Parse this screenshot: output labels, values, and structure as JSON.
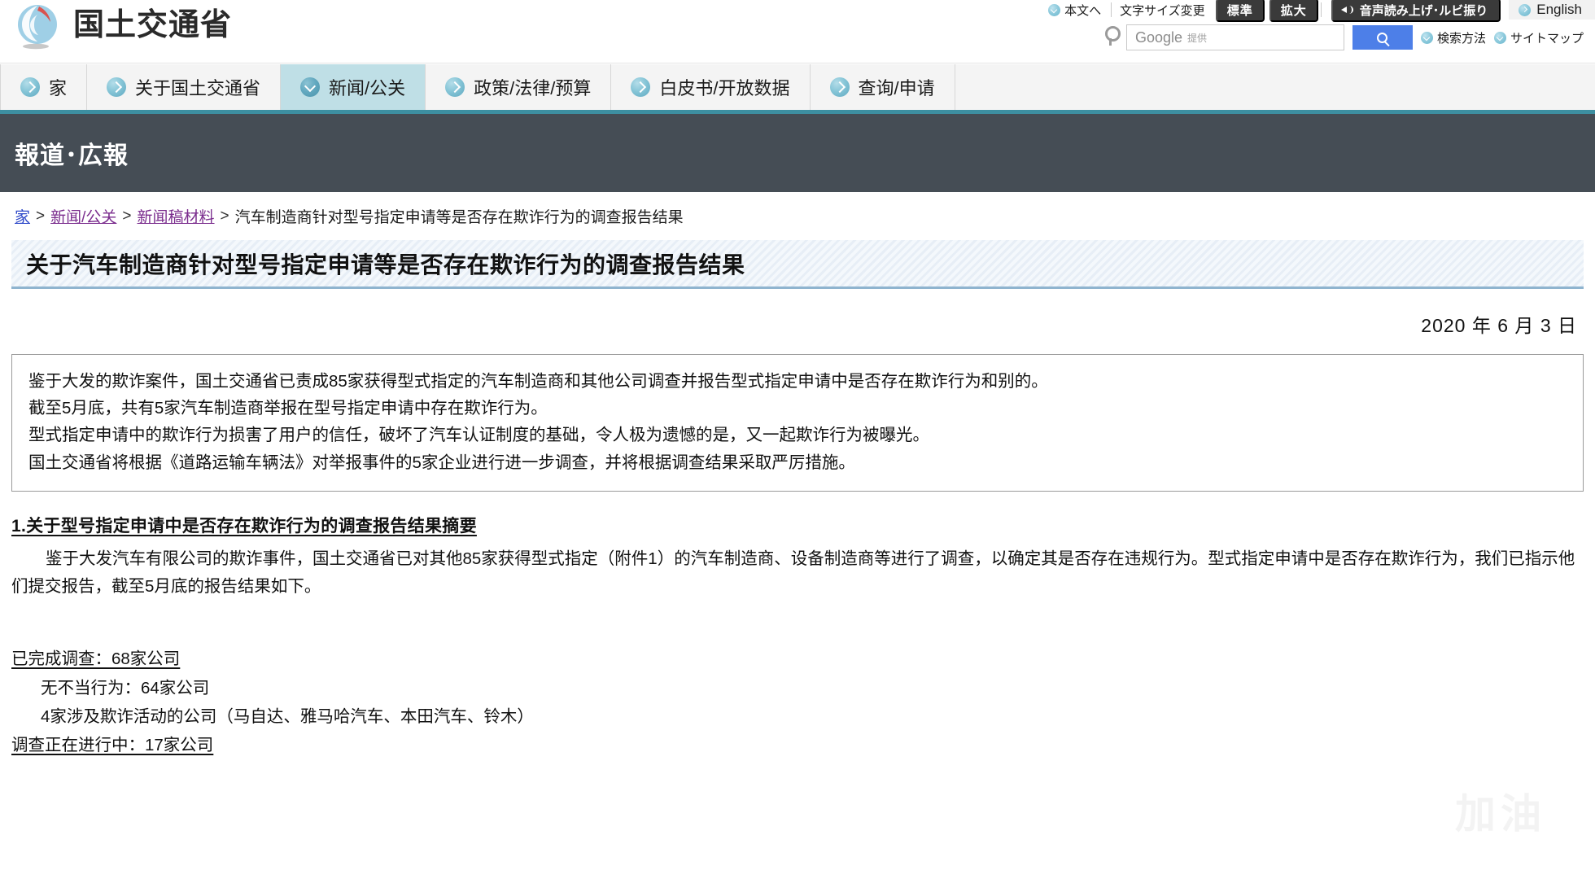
{
  "header": {
    "site_name": "国土交通省",
    "logo_icon": "mlit-swirl-logo-icon",
    "utility": {
      "skip_to_content": "本文へ",
      "skip_icon": "chevron-down-circle-icon",
      "font_size_label": "文字サイズ変更",
      "size_standard": "標準",
      "size_large": "拡大",
      "speech_label": "音声読み上げ･ルビ振り",
      "speech_icon": "speaker-icon",
      "english_label": "English",
      "english_icon": "chevron-right-circle-icon"
    },
    "search": {
      "person_icon": "person-icon",
      "placeholder_main": "Google",
      "placeholder_sub": "提供",
      "value": "",
      "button_icon": "search-icon",
      "how_to_search": "検索方法",
      "how_to_search_icon": "chevron-right-circle-icon",
      "sitemap": "サイトマップ",
      "sitemap_icon": "chevron-right-circle-icon"
    }
  },
  "nav": {
    "items": [
      {
        "label": "家",
        "active": false
      },
      {
        "label": "关于国土交通省",
        "active": false
      },
      {
        "label": "新闻/公关",
        "active": true
      },
      {
        "label": "政策/法律/预算",
        "active": false
      },
      {
        "label": "白皮书/开放数据",
        "active": false
      },
      {
        "label": "查询/申请",
        "active": false
      }
    ]
  },
  "band": {
    "title": "報道･広報"
  },
  "breadcrumb": {
    "items": [
      {
        "label": "家",
        "link": true,
        "home": true
      },
      {
        "label": "新闻/公关",
        "link": true,
        "home": false
      },
      {
        "label": "新闻稿材料",
        "link": true,
        "home": false
      },
      {
        "label": "汽车制造商针对型号指定申请等是否存在欺诈行为的调查报告结果",
        "link": false,
        "home": false
      }
    ],
    "separator": ">"
  },
  "page": {
    "title": "关于汽车制造商针对型号指定申请等是否存在欺诈行为的调查报告结果",
    "date": "2020 年 6 月 3 日"
  },
  "summary": {
    "lines": [
      "鉴于大发的欺诈案件，国土交通省已责成85家获得型式指定的汽车制造商和其他公司调查并报告型式指定申请中是否存在欺诈行为和别的。",
      "截至5月底，共有5家汽车制造商举报在型号指定申请中存在欺诈行为。",
      "型式指定申请中的欺诈行为损害了用户的信任，破坏了汽车认证制度的基础，令人极为遗憾的是，又一起欺诈行为被曝光。",
      "国土交通省将根据《道路运输车辆法》对举报事件的5家企业进行进一步调查，并将根据调查结果采取严厉措施。"
    ]
  },
  "section1": {
    "heading": "1.关于型号指定申请中是否存在欺诈行为的调查报告结果摘要",
    "paragraph": "鉴于大发汽车有限公司的欺诈事件，国土交通省已对其他85家获得型式指定（附件1）的汽车制造商、设备制造商等进行了调查，以确定其是否存在违规行为。型式指定申请中是否存在欺诈行为，我们已指示他们提交报告，截至5月底的报告结果如下。",
    "completed_head": "已完成调查：68家公司",
    "completed_sub1": "无不当行为：64家公司",
    "completed_sub2": "4家涉及欺诈活动的公司（马自达、雅马哈汽车、本田汽车、铃木）",
    "ongoing_head": "调查正在进行中：17家公司"
  },
  "watermark": {
    "text": "加油"
  },
  "colors": {
    "nav_active_bg": "#bfdfe6",
    "nav_underline": "#3d8fa1",
    "band_bg": "#454d55",
    "search_button": "#4d7fe8",
    "link_visited": "#7b2d8e",
    "link_home": "#2f49c9"
  }
}
